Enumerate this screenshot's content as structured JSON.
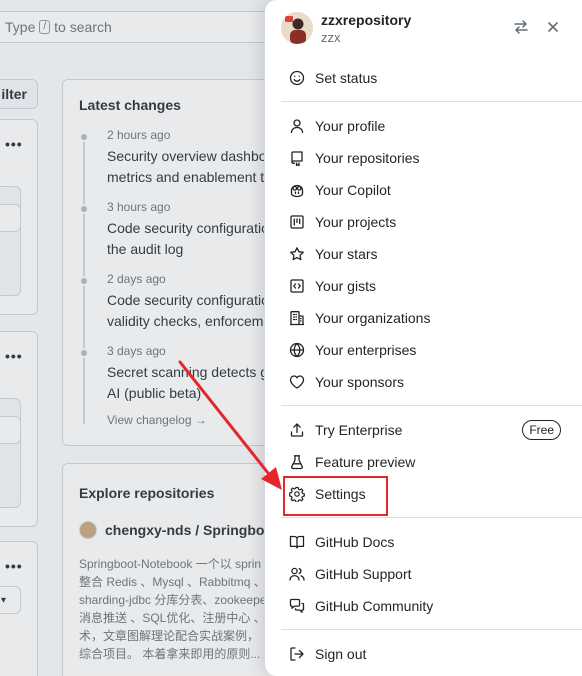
{
  "background": {
    "search_placeholder_prefix": "Type",
    "search_key": "/",
    "search_placeholder_suffix": "to search",
    "filter_label": "ilter",
    "more_glyph": "•••",
    "latest_changes": {
      "title": "Latest changes",
      "entries": [
        {
          "time": "2 hours ago",
          "line1": "Security overview dashbo",
          "line2": "metrics and enablement t"
        },
        {
          "time": "3 hours ago",
          "line1": "Code security configuratio",
          "line2": "the audit log"
        },
        {
          "time": "2 days ago",
          "line1": "Code security configuratio",
          "line2": "validity checks, enforcem"
        },
        {
          "time": "3 days ago",
          "line1": "Secret scanning detects g",
          "line2": "AI (public beta)"
        }
      ],
      "view_changelog": "View changelog →"
    },
    "explore": {
      "title": "Explore repositories",
      "repo_name": "chengxy-nds / Springboot",
      "desc_lines": [
        "Springboot-Notebook 一个以 sprin",
        "整合 Redis 、Mysql 、Rabbitmq 、",
        "sharding-jdbc 分库分表、zookeepe",
        "消息推送 、SQL优化、注册中心 、",
        "术，文章图解理论配合实战案例，",
        "综合项目。 本着拿来即用的原则..."
      ]
    }
  },
  "menu": {
    "username": "zzxrepository",
    "handle": "zzx",
    "switch_icon": "arrow-switch-icon",
    "close_icon": "x-close-icon",
    "set_status": {
      "label": "Set status",
      "icon": "smiley-icon"
    },
    "group1": [
      {
        "label": "Your profile",
        "icon": "person-icon"
      },
      {
        "label": "Your repositories",
        "icon": "repo-icon"
      },
      {
        "label": "Your Copilot",
        "icon": "copilot-icon"
      },
      {
        "label": "Your projects",
        "icon": "project-icon"
      },
      {
        "label": "Your stars",
        "icon": "star-icon"
      },
      {
        "label": "Your gists",
        "icon": "code-square-icon"
      },
      {
        "label": "Your organizations",
        "icon": "organization-icon"
      },
      {
        "label": "Your enterprises",
        "icon": "globe-icon"
      },
      {
        "label": "Your sponsors",
        "icon": "heart-icon"
      }
    ],
    "group2": [
      {
        "label": "Try Enterprise",
        "icon": "upload-icon",
        "badge": "Free"
      },
      {
        "label": "Feature preview",
        "icon": "beaker-icon"
      },
      {
        "label": "Settings",
        "icon": "gear-icon"
      }
    ],
    "group3": [
      {
        "label": "GitHub Docs",
        "icon": "book-icon"
      },
      {
        "label": "GitHub Support",
        "icon": "people-icon"
      },
      {
        "label": "GitHub Community",
        "icon": "comment-discussion-icon"
      }
    ],
    "sign_out": {
      "label": "Sign out",
      "icon": "sign-out-icon"
    }
  },
  "annotation": {
    "highlight_color": "#e5262a",
    "target": "Settings"
  }
}
